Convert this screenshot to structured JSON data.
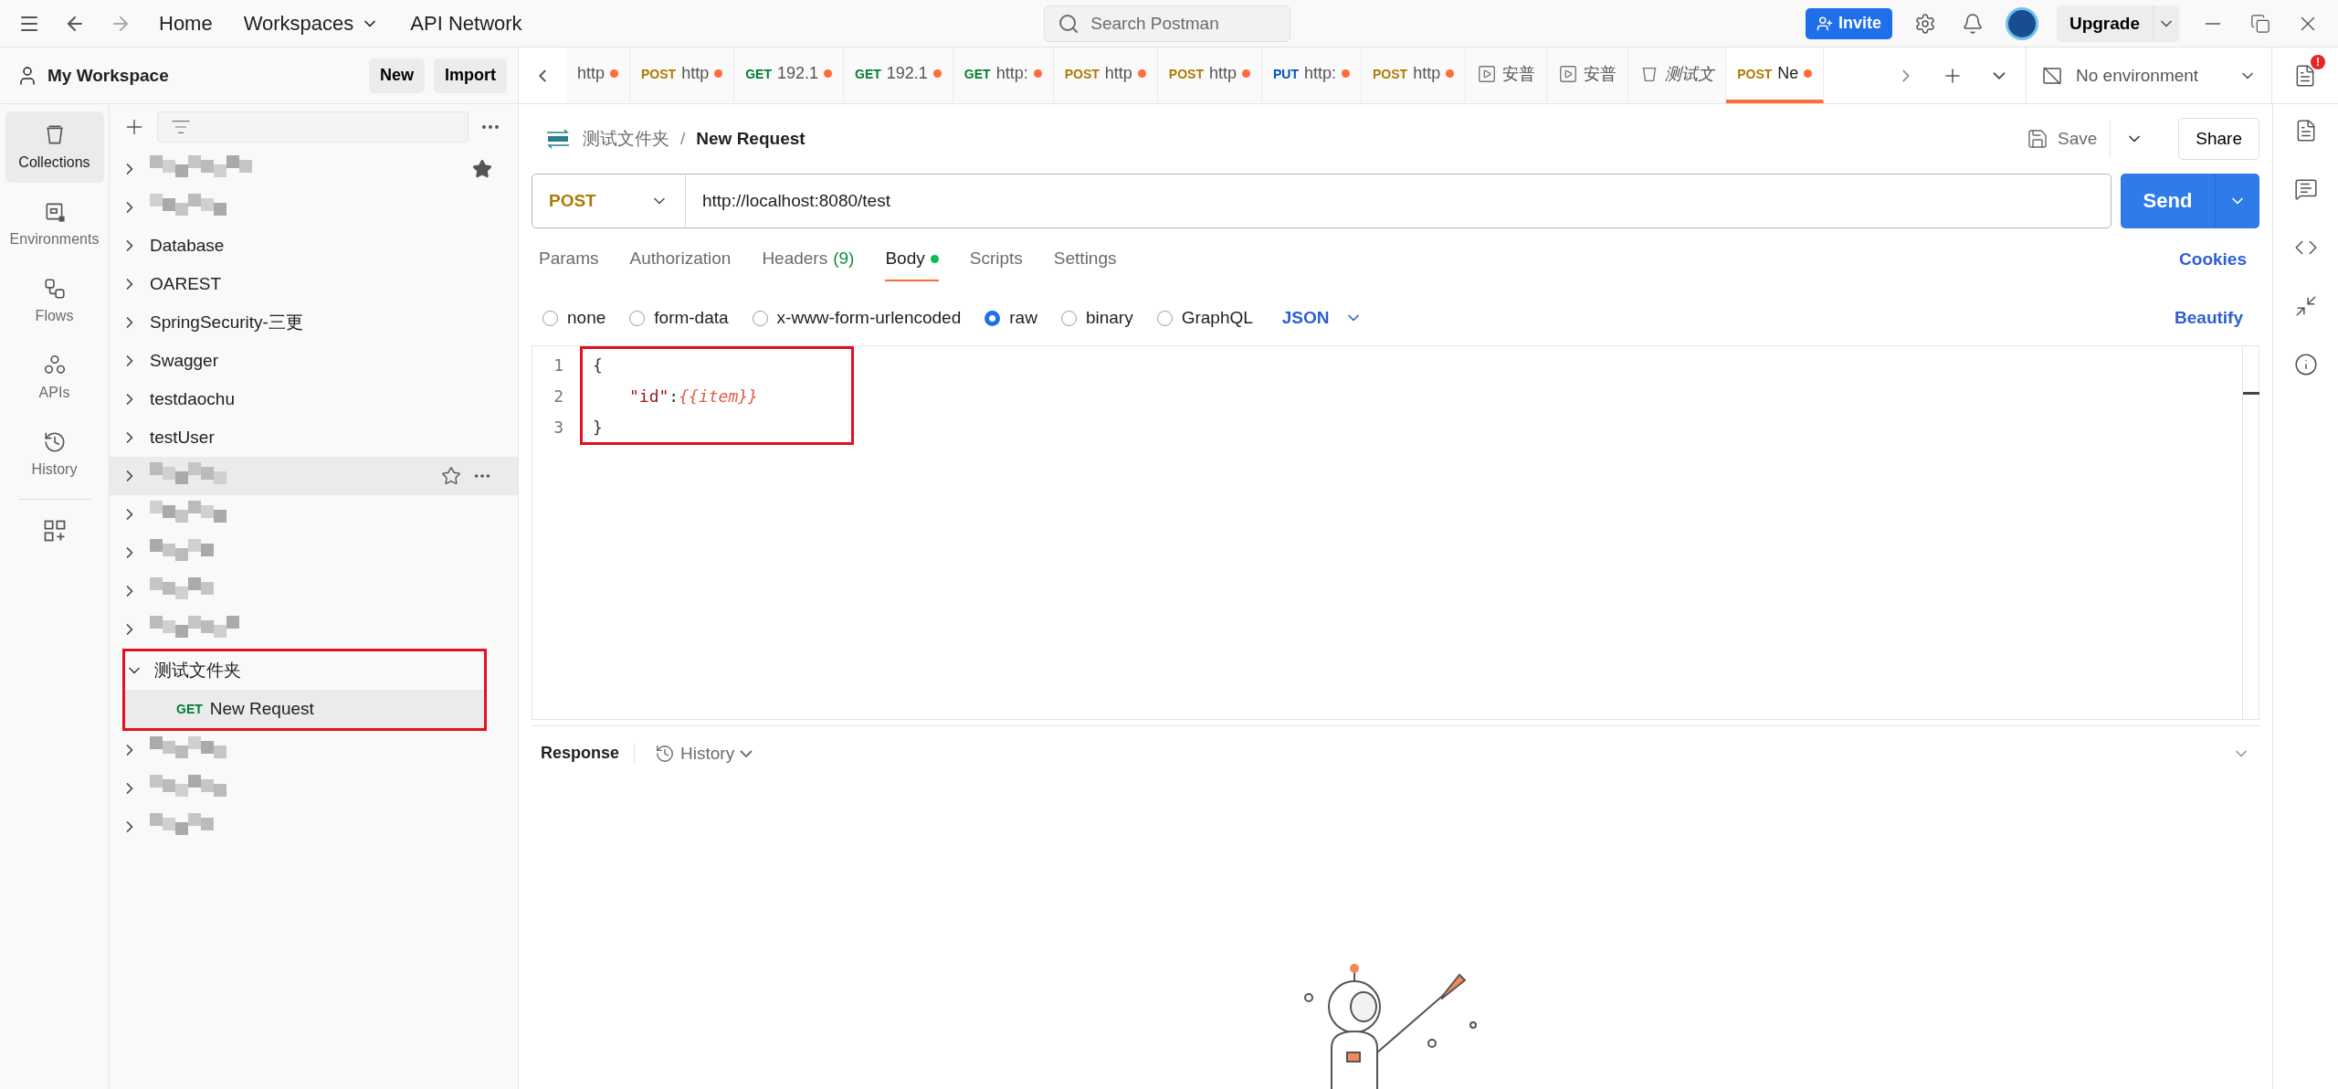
{
  "title_bar": {
    "nav": [
      {
        "label": "Home",
        "dropdown": false
      },
      {
        "label": "Workspaces",
        "dropdown": true
      },
      {
        "label": "API Network",
        "dropdown": false
      }
    ],
    "search": {
      "placeholder": "Search Postman"
    },
    "invite": "Invite",
    "upgrade": "Upgrade"
  },
  "workspace": {
    "name": "My Workspace",
    "buttons": [
      "New",
      "Import"
    ]
  },
  "rail": [
    {
      "label": "Collections",
      "kind": "collections",
      "selected": true
    },
    {
      "label": "Environments",
      "kind": "environments",
      "selected": false
    },
    {
      "label": "Flows",
      "kind": "flows",
      "selected": false
    },
    {
      "label": "APIs",
      "kind": "apis",
      "selected": false
    },
    {
      "label": "History",
      "kind": "history",
      "selected": false
    }
  ],
  "tabs": [
    {
      "kind": "request",
      "label": "http",
      "unsaved": true,
      "selected": false
    },
    {
      "kind": "request",
      "method": "POST",
      "color": "#ad7a03",
      "label": "http",
      "unsaved": true,
      "selected": false
    },
    {
      "kind": "request",
      "method": "GET",
      "color": "#007f31",
      "label": "192.1",
      "unsaved": true,
      "selected": false
    },
    {
      "kind": "request",
      "method": "GET",
      "color": "#007f31",
      "label": "192.1",
      "unsaved": true,
      "selected": false
    },
    {
      "kind": "request",
      "method": "GET",
      "color": "#007f31",
      "label": "http:",
      "unsaved": true,
      "selected": false
    },
    {
      "kind": "request",
      "method": "POST",
      "color": "#ad7a03",
      "label": "http",
      "unsaved": true,
      "selected": false
    },
    {
      "kind": "request",
      "method": "POST",
      "color": "#ad7a03",
      "label": "http",
      "unsaved": true,
      "selected": false
    },
    {
      "kind": "request",
      "method": "PUT",
      "color": "#0053b8",
      "label": "http:",
      "unsaved": true,
      "selected": false
    },
    {
      "kind": "request",
      "method": "POST",
      "color": "#ad7a03",
      "label": "http",
      "unsaved": true,
      "selected": false
    },
    {
      "kind": "runner",
      "label": "安普",
      "unsaved": false,
      "selected": false
    },
    {
      "kind": "runner",
      "label": "安普",
      "unsaved": false,
      "selected": false
    },
    {
      "kind": "collection",
      "label": "测试文",
      "unsaved": false,
      "selected": false
    },
    {
      "kind": "request",
      "method": "POST",
      "color": "#ad7a03",
      "label": "Ne",
      "unsaved": true,
      "selected": true
    }
  ],
  "environment": "No environment",
  "notification_badge": "!",
  "tree": [
    {
      "kind": "redacted",
      "starred": true,
      "hovered": false,
      "expanded": false
    },
    {
      "kind": "redacted",
      "starred": false,
      "hovered": false,
      "expanded": false
    },
    {
      "kind": "collection",
      "label": "Database",
      "starred": false,
      "hovered": false,
      "expanded": false
    },
    {
      "kind": "collection",
      "label": "OAREST",
      "starred": false,
      "hovered": false,
      "expanded": false
    },
    {
      "kind": "collection",
      "label": "SpringSecurity-三更",
      "starred": false,
      "hovered": false,
      "expanded": false
    },
    {
      "kind": "collection",
      "label": "Swagger",
      "starred": false,
      "hovered": false,
      "expanded": false
    },
    {
      "kind": "collection",
      "label": "testdaochu",
      "starred": false,
      "hovered": false,
      "expanded": false
    },
    {
      "kind": "collection",
      "label": "testUser",
      "starred": false,
      "hovered": false,
      "expanded": false
    },
    {
      "kind": "redacted",
      "starred": false,
      "hovered": true,
      "expanded": false
    },
    {
      "kind": "redacted",
      "starred": false,
      "hovered": false,
      "expanded": false
    },
    {
      "kind": "redacted",
      "starred": false,
      "hovered": false,
      "expanded": false
    },
    {
      "kind": "redacted",
      "starred": false,
      "hovered": false,
      "expanded": false
    },
    {
      "kind": "redacted",
      "starred": false,
      "hovered": false,
      "expanded": false
    },
    {
      "kind": "collection",
      "label": "测试文件夹",
      "starred": false,
      "hovered": false,
      "expanded": true,
      "annotated": true,
      "children": [
        {
          "method": "GET",
          "color": "#007f31",
          "label": "New Request",
          "selected": true
        }
      ]
    },
    {
      "kind": "redacted",
      "starred": false,
      "hovered": false,
      "expanded": false
    },
    {
      "kind": "redacted",
      "starred": false,
      "hovered": false,
      "expanded": false
    },
    {
      "kind": "redacted",
      "starred": false,
      "hovered": false,
      "expanded": false
    }
  ],
  "request": {
    "breadcrumb": [
      "测试文件夹",
      "New Request"
    ],
    "breadcrumb_separator": "/",
    "save": "Save",
    "share": "Share",
    "method": "POST",
    "url": "http://localhost:8080/test",
    "send": "Send",
    "tabs": [
      {
        "label": "Params",
        "selected": false,
        "modified": false
      },
      {
        "label": "Authorization",
        "selected": false,
        "modified": false
      },
      {
        "label": "Headers",
        "count": "(9)",
        "selected": false,
        "modified": false
      },
      {
        "label": "Body",
        "selected": true,
        "modified": true
      },
      {
        "label": "Scripts",
        "selected": false,
        "modified": false
      },
      {
        "label": "Settings",
        "selected": false,
        "modified": false
      }
    ],
    "cookies": "Cookies",
    "body_types": [
      {
        "label": "none",
        "selected": false
      },
      {
        "label": "form-data",
        "selected": false
      },
      {
        "label": "x-www-form-urlencoded",
        "selected": false
      },
      {
        "label": "raw",
        "selected": true
      },
      {
        "label": "binary",
        "selected": false
      },
      {
        "label": "GraphQL",
        "selected": false
      }
    ],
    "language": "JSON",
    "beautify": "Beautify",
    "code_annotated": true,
    "code": [
      {
        "number": "1",
        "tokens": [
          {
            "kind": "punct",
            "text": "{"
          }
        ]
      },
      {
        "number": "2",
        "tokens": [
          {
            "kind": "key",
            "text": "\"id\""
          },
          {
            "kind": "punct",
            "text": ":"
          },
          {
            "kind": "variable",
            "text": "{{item}}"
          }
        ]
      },
      {
        "number": "3",
        "tokens": [
          {
            "kind": "punct",
            "text": "}"
          }
        ]
      }
    ]
  },
  "response": {
    "title": "Response",
    "history": "History"
  }
}
